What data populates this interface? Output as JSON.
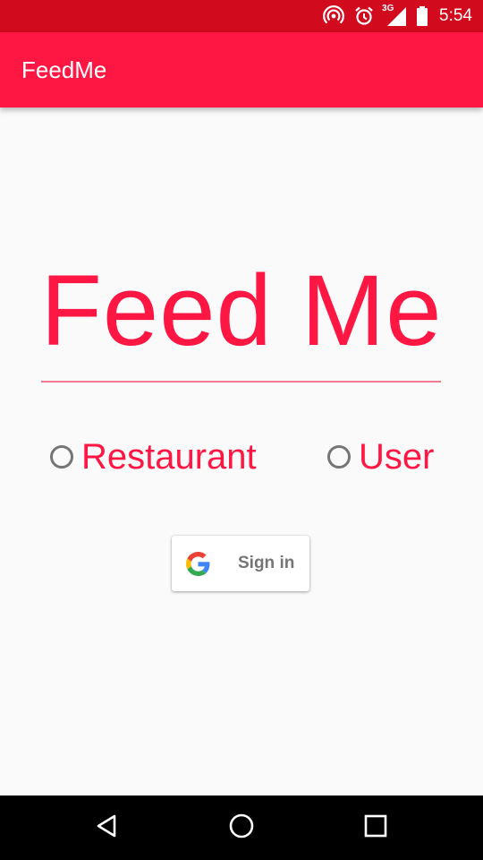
{
  "status_bar": {
    "time": "5:54",
    "network": "3G",
    "background_color": "#d10a1d",
    "icons": [
      "hotspot-icon",
      "alarm-icon",
      "signal-icon",
      "battery-icon"
    ]
  },
  "app_bar": {
    "title": "FeedMe",
    "background_color": "#ff1744"
  },
  "main": {
    "title": "Feed Me",
    "accent_color": "#ff1744",
    "role_options": [
      {
        "label": "Restaurant",
        "selected": false
      },
      {
        "label": "User",
        "selected": false
      }
    ],
    "signin": {
      "label": "Sign in",
      "icon": "google-icon"
    }
  },
  "nav_bar": {
    "buttons": [
      "back-icon",
      "home-icon",
      "recents-icon"
    ]
  }
}
